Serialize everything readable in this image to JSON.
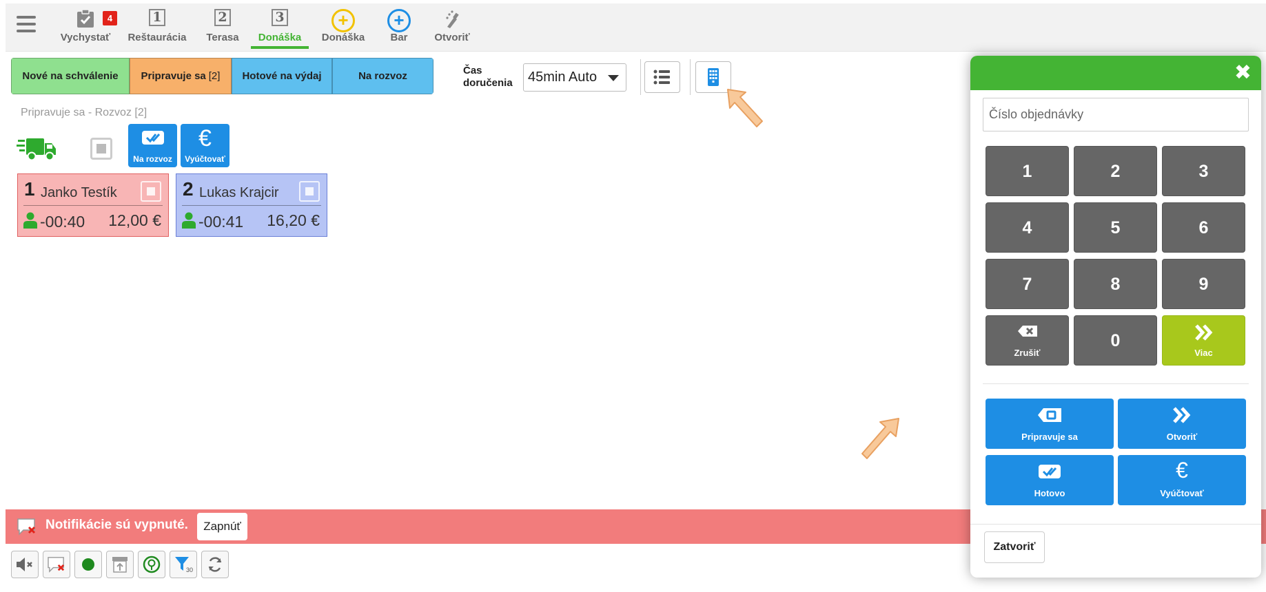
{
  "nav": {
    "badge": "4",
    "tabs": [
      {
        "label": "Vychystať"
      },
      {
        "label": "Reštaurácia",
        "num": "1"
      },
      {
        "label": "Terasa",
        "num": "2"
      },
      {
        "label": "Donáška",
        "num": "3"
      },
      {
        "label": "Donáška",
        "symbol": "+"
      },
      {
        "label": "Bar",
        "symbol": "+"
      },
      {
        "label": "Otvoriť"
      }
    ]
  },
  "status_tabs": [
    {
      "label": "Nové na schválenie",
      "color": "#8fe08f"
    },
    {
      "label": "Pripravuje sa",
      "count": "[2]",
      "color": "#f7b06a"
    },
    {
      "label": "Hotové na výdaj",
      "color": "#5ebfef"
    },
    {
      "label": "Na rozvoz",
      "color": "#5ebfef"
    }
  ],
  "delivery": {
    "label_line1": "Čas",
    "label_line2": "doručenia",
    "value": "45min Auto"
  },
  "section_title": "Pripravuje sa - Rozvoz [2]",
  "actions": {
    "na_rozvoz": "Na rozvoz",
    "vyuctovat": "Vyúčtovať"
  },
  "orders": [
    {
      "num": "1",
      "name": "Janko Testík",
      "time": "-00:40",
      "price": "12,00 €",
      "color": "#f8b5b5",
      "border": "#e06060"
    },
    {
      "num": "2",
      "name": "Lukas Krajcir",
      "time": "-00:41",
      "price": "16,20 €",
      "color": "#b6c4f5",
      "border": "#6a7fd6"
    }
  ],
  "notification": {
    "text": "Notifikácie sú vypnuté.",
    "button": "Zapnúť"
  },
  "dialog": {
    "placeholder": "Číslo objednávky",
    "keys": [
      "1",
      "2",
      "3",
      "4",
      "5",
      "6",
      "7",
      "8",
      "9"
    ],
    "zero": "0",
    "cancel_label": "Zrušiť",
    "more_label": "Viac",
    "buttons": [
      {
        "label": "Pripravuje sa"
      },
      {
        "label": "Otvoriť"
      },
      {
        "label": "Hotovo"
      },
      {
        "label": "Vyúčtovať"
      }
    ],
    "close_button": "Zatvoriť"
  },
  "colors": {
    "green": "#44b434",
    "blue": "#1e8ee4",
    "lime": "#a8c81c",
    "notif_red": "#f27c7c"
  }
}
